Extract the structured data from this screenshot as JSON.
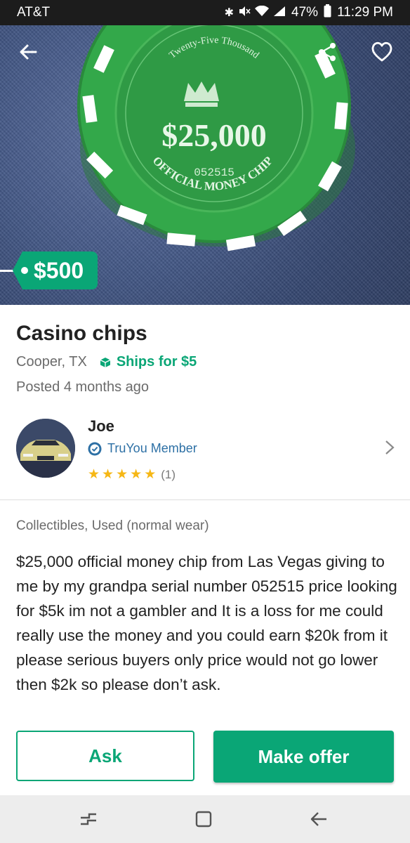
{
  "status_bar": {
    "carrier": "AT&T",
    "battery": "47%",
    "time": "11:29 PM"
  },
  "hero": {
    "price": "$500",
    "chip": {
      "arc_text": "Twenty-Five Thousand",
      "amount": "$25,000",
      "serial": "052515",
      "bottom_text": "OFFICIAL MONEY CHIP"
    }
  },
  "listing": {
    "title": "Casino chips",
    "location": "Cooper, TX",
    "shipping": "Ships for $5",
    "posted": "Posted 4 months ago",
    "category": "Collectibles, Used (normal wear)",
    "description": "$25,000 official money chip from Las Vegas giving to me by my grandpa serial number 052515 price looking for $5k im not a gambler and It is a loss for me could really use the money and you could earn $20k from it please serious buyers only price would not go lower then $2k so please don’t ask."
  },
  "seller": {
    "name": "Joe",
    "badge": "TruYou Member",
    "rating": 5,
    "rating_count": "(1)"
  },
  "actions": {
    "ask_label": "Ask",
    "offer_label": "Make offer"
  },
  "colors": {
    "accent": "#0aa676",
    "link_blue": "#2d70a5",
    "star": "#f6b715"
  }
}
